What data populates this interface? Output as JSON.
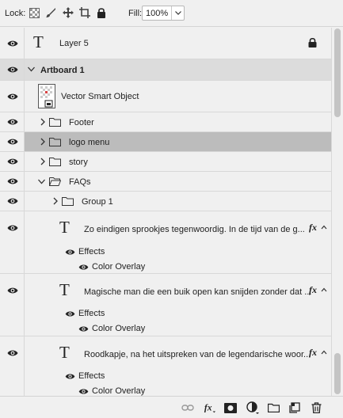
{
  "toolbar": {
    "lock_label": "Lock:",
    "fill_label": "Fill:",
    "fill_value": "100%"
  },
  "layers": {
    "layer5": {
      "name": "Layer 5"
    },
    "artboard": {
      "name": "Artboard 1"
    },
    "vector_smart_object": {
      "name": "Vector Smart Object"
    },
    "footer": {
      "name": "Footer"
    },
    "logo_menu": {
      "name": "logo menu"
    },
    "story": {
      "name": "story"
    },
    "faqs": {
      "name": "FAQs"
    },
    "group1": {
      "name": "Group 1"
    },
    "text1": {
      "name": "Zo eindigen sprookjes tegenwoordig. In de tijd  van de g...",
      "effects": "Effects",
      "overlay": "Color Overlay"
    },
    "text2": {
      "name": "Magische man die een buik open kan snijden zonder dat ...",
      "effects": "Effects",
      "overlay": "Color Overlay"
    },
    "text3": {
      "name": "Roodkapje, na het uitspreken van de legendarische woor...",
      "effects": "Effects",
      "overlay": "Color Overlay"
    }
  },
  "glyphs": {
    "text_layer": "T",
    "fx": "fx"
  },
  "colors": {
    "selected_row": "#bcbcbc",
    "artboard_row": "#dcdcdc",
    "panel_bg": "#f0f0f0"
  }
}
